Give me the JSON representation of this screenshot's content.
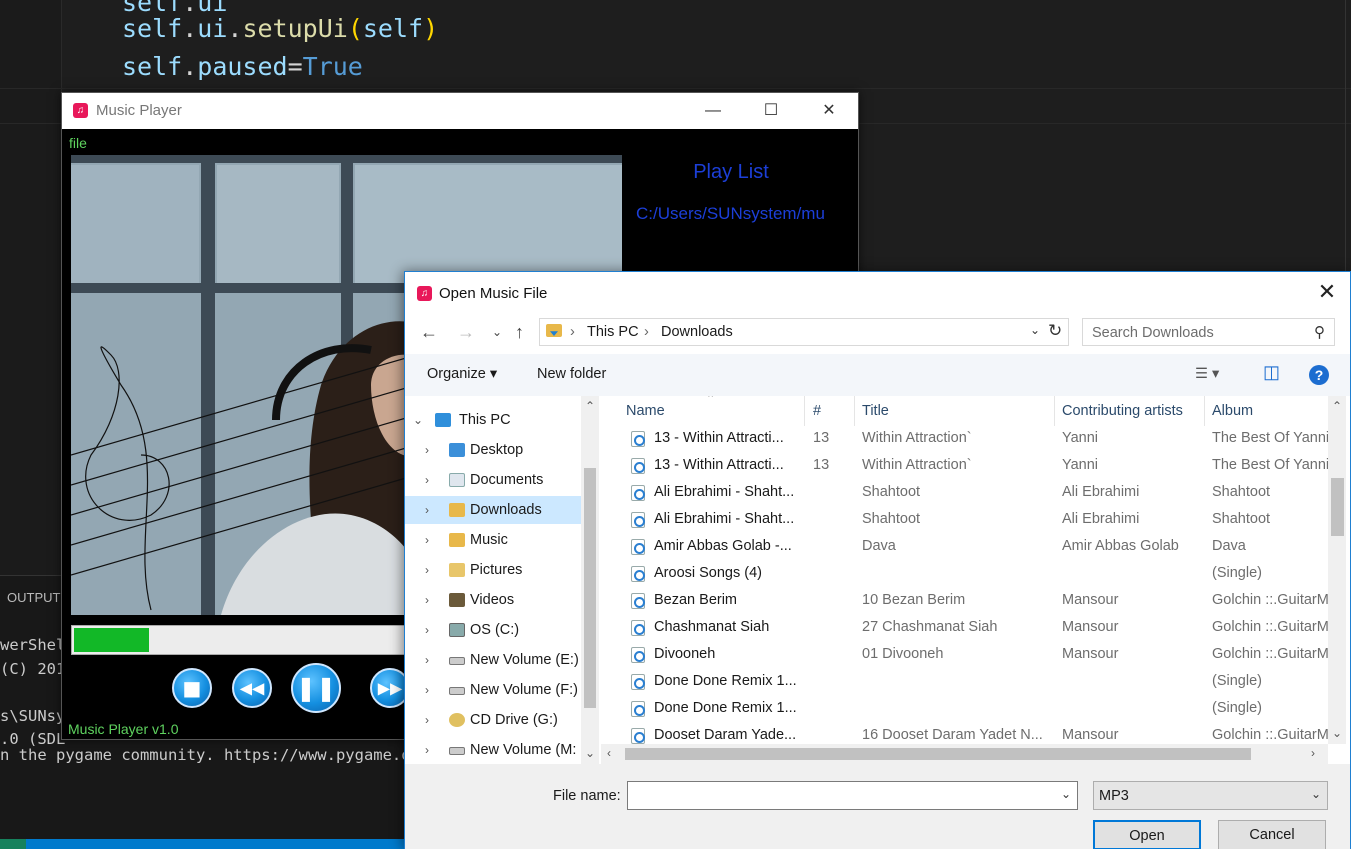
{
  "editor": {
    "line1": {
      "a": "self",
      "b": ".",
      "c": "ui",
      "d": ".",
      "e": "setupUi",
      "f": "(",
      "g": "self",
      "h": ")"
    },
    "line2": {
      "a": "self",
      "b": ".",
      "c": "paused",
      "d": "=",
      "e": "True"
    }
  },
  "panel": {
    "tab": "OUTPUT",
    "terminal_lines": [
      "werShel",
      "(C) 201",
      "",
      "s\\SUNsy",
      ".0 (SDL",
      "n the pygame community. https://www.pygame.org"
    ]
  },
  "player": {
    "title": "Music Player",
    "menu_file": "file",
    "playlist_title": "Play List",
    "playlist_items": [
      "C:/Users/SUNsystem/mu"
    ],
    "progress": 0.19,
    "footer": "Music Player v1.0",
    "icons": {
      "app": "music-note-icon",
      "stop": "stop-icon",
      "rewind": "rewind-icon",
      "pause": "pause-icon",
      "forward": "fast-forward-icon"
    }
  },
  "dialog": {
    "title": "Open Music File",
    "breadcrumb": [
      "This PC",
      "Downloads"
    ],
    "search_placeholder": "Search Downloads",
    "toolbar": {
      "organize": "Organize ▾",
      "new_folder": "New folder"
    },
    "tree": [
      {
        "label": "This PC",
        "icon": "computer-icon",
        "selected": false
      },
      {
        "label": "Desktop",
        "icon": "desktop-folder-icon",
        "selected": false
      },
      {
        "label": "Documents",
        "icon": "documents-folder-icon",
        "selected": false
      },
      {
        "label": "Downloads",
        "icon": "downloads-folder-icon",
        "selected": true
      },
      {
        "label": "Music",
        "icon": "music-folder-icon",
        "selected": false
      },
      {
        "label": "Pictures",
        "icon": "pictures-folder-icon",
        "selected": false
      },
      {
        "label": "Videos",
        "icon": "videos-folder-icon",
        "selected": false
      },
      {
        "label": "OS (C:)",
        "icon": "windows-drive-icon",
        "selected": false
      },
      {
        "label": "New Volume (E:)",
        "icon": "drive-icon",
        "selected": false
      },
      {
        "label": "New Volume (F:)",
        "icon": "drive-icon",
        "selected": false
      },
      {
        "label": "CD Drive (G:)",
        "icon": "cd-drive-icon",
        "selected": false
      },
      {
        "label": "New Volume (M:",
        "icon": "drive-icon",
        "selected": false
      }
    ],
    "columns": [
      "Name",
      "#",
      "Title",
      "Contributing artists",
      "Album"
    ],
    "files": [
      {
        "name": "13 - Within Attracti...",
        "num": "13",
        "title": "Within Attraction`",
        "artist": "Yanni",
        "album": "The Best Of Yanni"
      },
      {
        "name": "13 - Within Attracti...",
        "num": "13",
        "title": "Within Attraction`",
        "artist": "Yanni",
        "album": "The Best Of Yanni"
      },
      {
        "name": "Ali Ebrahimi - Shaht...",
        "num": "",
        "title": "Shahtoot",
        "artist": "Ali Ebrahimi",
        "album": "Shahtoot"
      },
      {
        "name": "Ali Ebrahimi - Shaht...",
        "num": "",
        "title": "Shahtoot",
        "artist": "Ali Ebrahimi",
        "album": "Shahtoot"
      },
      {
        "name": "Amir Abbas Golab -...",
        "num": "",
        "title": "Dava",
        "artist": "Amir Abbas Golab",
        "album": "Dava"
      },
      {
        "name": "Aroosi Songs (4)",
        "num": "",
        "title": "",
        "artist": "",
        "album": "(Single)"
      },
      {
        "name": "Bezan Berim",
        "num": "",
        "title": "10 Bezan Berim",
        "artist": "Mansour",
        "album": "Golchin ::.GuitarM"
      },
      {
        "name": "Chashmanat Siah",
        "num": "",
        "title": "27 Chashmanat Siah",
        "artist": "Mansour",
        "album": "Golchin ::.GuitarM"
      },
      {
        "name": "Divooneh",
        "num": "",
        "title": "01 Divooneh",
        "artist": "Mansour",
        "album": "Golchin ::.GuitarM"
      },
      {
        "name": "Done Done Remix 1...",
        "num": "",
        "title": "",
        "artist": "",
        "album": "(Single)"
      },
      {
        "name": "Done Done Remix 1...",
        "num": "",
        "title": "",
        "artist": "",
        "album": "(Single)"
      },
      {
        "name": "Dooset Daram Yade...",
        "num": "",
        "title": "16 Dooset Daram Yadet N...",
        "artist": "Mansour",
        "album": "Golchin ::.GuitarM"
      }
    ],
    "file_name_label": "File name:",
    "file_name_value": "",
    "file_type": "MP3",
    "open_button": "Open",
    "cancel_button": "Cancel"
  }
}
